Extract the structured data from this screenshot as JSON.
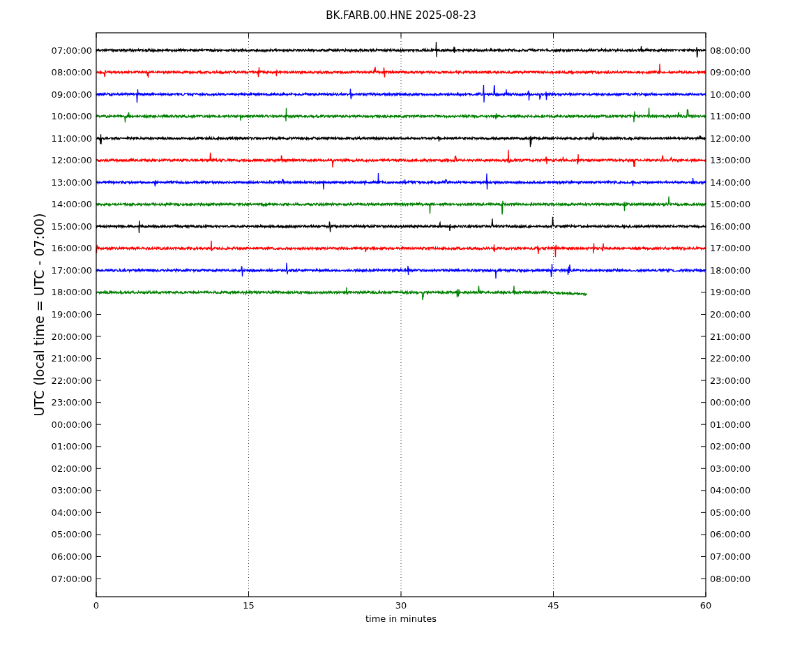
{
  "title": "BK.FARB.00.HNE 2025-08-23",
  "y_axis": {
    "label": "UTC (local time = UTC - 07:00)",
    "left_ticks": [
      "07:00:00",
      "08:00:00",
      "09:00:00",
      "10:00:00",
      "11:00:00",
      "12:00:00",
      "13:00:00",
      "14:00:00",
      "15:00:00",
      "16:00:00",
      "17:00:00",
      "18:00:00",
      "19:00:00",
      "20:00:00",
      "21:00:00",
      "22:00:00",
      "23:00:00",
      "00:00:00",
      "01:00:00",
      "02:00:00",
      "03:00:00",
      "04:00:00",
      "05:00:00",
      "06:00:00",
      "07:00:00"
    ],
    "right_ticks": [
      "08:00:00",
      "09:00:00",
      "10:00:00",
      "11:00:00",
      "12:00:00",
      "13:00:00",
      "14:00:00",
      "15:00:00",
      "16:00:00",
      "17:00:00",
      "18:00:00",
      "19:00:00",
      "20:00:00",
      "21:00:00",
      "22:00:00",
      "23:00:00",
      "00:00:00",
      "01:00:00",
      "02:00:00",
      "03:00:00",
      "04:00:00",
      "05:00:00",
      "06:00:00",
      "07:00:00",
      "08:00:00"
    ]
  },
  "x_axis": {
    "label": "time in minutes",
    "ticks": [
      "0",
      "15",
      "30",
      "45",
      "60"
    ]
  },
  "traces": [
    {
      "color": "#000000",
      "level": 1
    },
    {
      "color": "#ff0000",
      "level": 1
    },
    {
      "color": "#0000ff",
      "level": 1
    },
    {
      "color": "#008000",
      "level": 1
    },
    {
      "color": "#000000",
      "level": 1
    },
    {
      "color": "#ff0000",
      "level": 1
    },
    {
      "color": "#0000ff",
      "level": 1
    },
    {
      "color": "#008000",
      "level": 1
    },
    {
      "color": "#000000",
      "level": 1
    },
    {
      "color": "#ff0000",
      "level": 1
    },
    {
      "color": "#0000ff",
      "level": 1
    },
    {
      "color": "#008000",
      "level": 0.805
    }
  ]
}
